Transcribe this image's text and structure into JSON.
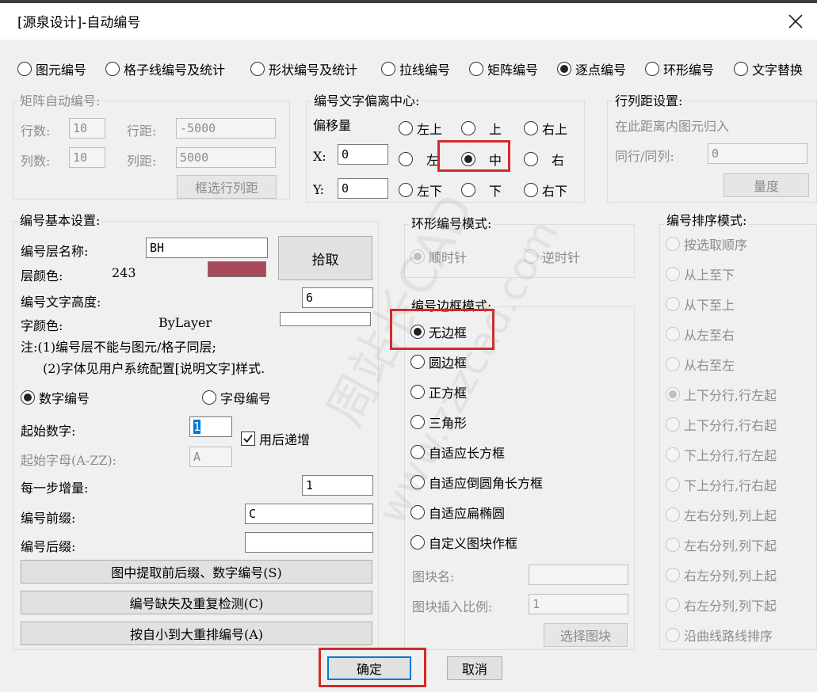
{
  "window": {
    "title": "[源泉设计]-自动编号"
  },
  "modes": [
    {
      "label": "图元编号",
      "selected": false
    },
    {
      "label": "格子线编号及统计",
      "selected": false
    },
    {
      "label": "形状编号及统计",
      "selected": false
    },
    {
      "label": "拉线编号",
      "selected": false
    },
    {
      "label": "矩阵编号",
      "selected": false
    },
    {
      "label": "逐点编号",
      "selected": true
    },
    {
      "label": "环形编号",
      "selected": false
    },
    {
      "label": "文字替换",
      "selected": false
    }
  ],
  "matrix": {
    "title": "矩阵自动编号:",
    "rows_label": "行数:",
    "rows_value": "10",
    "rowgap_label": "行距:",
    "rowgap_value": "-5000",
    "cols_label": "列数:",
    "cols_value": "10",
    "colgap_label": "列距:",
    "colgap_value": "5000",
    "select_button": "框选行列距"
  },
  "offset": {
    "title": "编号文字偏离中心:",
    "amount_label": "偏移量",
    "x_label": "X:",
    "x_value": "0",
    "y_label": "Y:",
    "y_value": "0",
    "positions": [
      "左上",
      "上",
      "右上",
      "左",
      "中",
      "右",
      "左下",
      "下",
      "右下"
    ],
    "selected": "中"
  },
  "rowcol": {
    "title": "行列距设置:",
    "hint": "在此距离内图元归入",
    "same_label": "同行/同列:",
    "same_value": "0",
    "measure_button": "量度"
  },
  "basic": {
    "title": "编号基本设置:",
    "layer_label": "编号层名称:",
    "layer_value": "BH",
    "pick_button": "拾取",
    "layer_color_label": "层颜色:",
    "layer_color_value": "243",
    "layer_color": "#a94a5a",
    "text_height_label": "编号文字高度:",
    "text_height_value": "6",
    "font_color_label": "字颜色:",
    "font_color_value": "ByLayer",
    "note1": "注:(1)编号层不能与图元/格子同层;",
    "note2": "(2)字体见用户系统配置[说明文字]样式.",
    "numeric_label": "数字编号",
    "alpha_label": "字母编号",
    "numeric_selected": true,
    "start_num_label": "起始数字:",
    "start_num_value": "1",
    "auto_inc_label": "用后递增",
    "auto_inc_checked": true,
    "start_letter_label": "起始字母(A-ZZ):",
    "start_letter_value": "A",
    "step_label": "每一步增量:",
    "step_value": "1",
    "prefix_label": "编号前缀:",
    "prefix_value": "C",
    "suffix_label": "编号后缀:",
    "suffix_value": "",
    "extract_button": "图中提取前后缀、数字编号(S)",
    "check_button": "编号缺失及重复检测(C)",
    "renumber_button": "按自小到大重排编号(A)"
  },
  "ring": {
    "title": "环形编号模式:",
    "cw_label": "顺时针",
    "ccw_label": "逆时针"
  },
  "frame": {
    "title": "编号边框模式:",
    "options": [
      "无边框",
      "圆边框",
      "正方框",
      "三角形",
      "自适应长方框",
      "自适应倒圆角长方框",
      "自适应扁椭圆",
      "自定义图块作框"
    ],
    "selected": "无边框",
    "block_name_label": "图块名:",
    "block_name_value": "",
    "block_scale_label": "图块插入比例:",
    "block_scale_value": "1",
    "select_block_button": "选择图块"
  },
  "sort": {
    "title": "编号排序模式:",
    "options": [
      "按选取顺序",
      "从上至下",
      "从下至上",
      "从左至右",
      "从右至左",
      "上下分行,行左起",
      "上下分行,行右起",
      "下上分行,行左起",
      "下上分行,行右起",
      "左右分列,列上起",
      "左右分列,列下起",
      "右左分列,列上起",
      "右左分列,列下起",
      "沿曲线路线排序"
    ],
    "selected": "上下分行,行左起"
  },
  "footer": {
    "ok": "确定",
    "cancel": "取消"
  },
  "watermark": {
    "line1": "周站长CAD",
    "line2": "www.zzzcad.com"
  }
}
